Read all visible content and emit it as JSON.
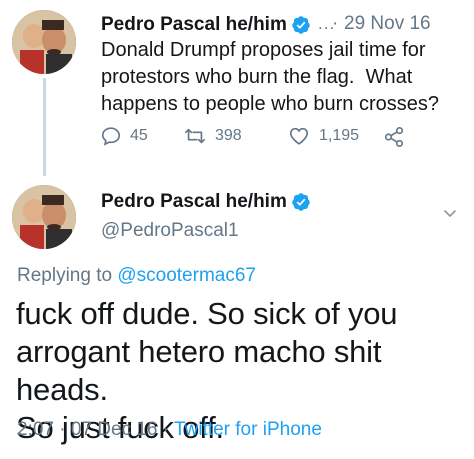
{
  "parent_tweet": {
    "author_name": "Pedro Pascal he/him",
    "dots": "...",
    "separator": "·",
    "date": "29 Nov 16",
    "text_lines": [
      "Donald Drumpf proposes jail time for",
      "protestors who burn the flag.  What",
      "happens to people who burn crosses?"
    ],
    "replies": "45",
    "retweets": "398",
    "likes": "1,195",
    "icons": {
      "reply": "reply-icon",
      "retweet": "retweet-icon",
      "like": "heart-icon",
      "share": "share-icon"
    }
  },
  "main_tweet": {
    "author_name": "Pedro Pascal he/him",
    "handle": "@PedroPascal1",
    "replying_prefix": "Replying to ",
    "replying_to": "@scootermac67",
    "text_lines": [
      "fuck off dude. So sick of you",
      "arrogant hetero macho shit heads.",
      "So just fuck off."
    ],
    "time": "2:07",
    "sep1": "·",
    "date": "07 Dec 16",
    "sep2": "·",
    "source": "Twitter for iPhone"
  },
  "colors": {
    "accent": "#1da1f2",
    "muted": "#657786",
    "text": "#14171a",
    "thread_line": "#ccd6dd"
  }
}
